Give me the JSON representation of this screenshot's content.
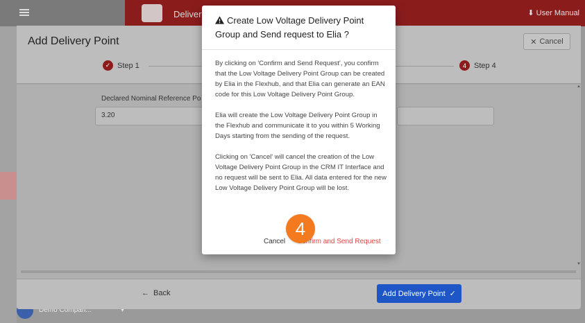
{
  "app": {
    "title": "Deliver",
    "user_manual": "User Manual",
    "user_name": "Demo Compan..."
  },
  "panel": {
    "title": "Add Delivery Point",
    "cancel_label": "Cancel",
    "steps": [
      {
        "number": "",
        "label": "Step 1",
        "state": "done"
      },
      {
        "number": "4",
        "label": "Step 4",
        "state": "current"
      }
    ],
    "field_label": "Declared Nominal Reference Po",
    "field_value": "3.20",
    "back_label": "Back",
    "add_label": "Add Delivery Point"
  },
  "dialog": {
    "title": "Create Low Voltage Delivery Point Group and Send request to Elia ?",
    "paragraphs": [
      "By clicking on 'Confirm and Send Request', you confirm that the Low Voltage Delivery Point Group can be created by Elia in the Flexhub, and that Elia can generate an EAN code for this Low Voltage Delivery Point Group.",
      "Elia will create the Low Voltage Delivery Point Group in the Flexhub and communicate it to you within 5 Working Days starting from the sending of the request.",
      "Clicking on 'Cancel' will cancel the creation of the Low Voltage Delivery Point Group in the CRM IT Interface and no request will be sent to Elia. All data entered for the new Low Voltage Delivery Point Group will be lost."
    ],
    "cancel_label": "Cancel",
    "confirm_label": "Confirm and Send Request"
  },
  "annotation": {
    "badge": "4"
  },
  "colors": {
    "accent_red": "#8e1b1b",
    "confirm_red": "#e04545",
    "primary_blue": "#1f56c7",
    "badge_orange": "#f47a20"
  }
}
